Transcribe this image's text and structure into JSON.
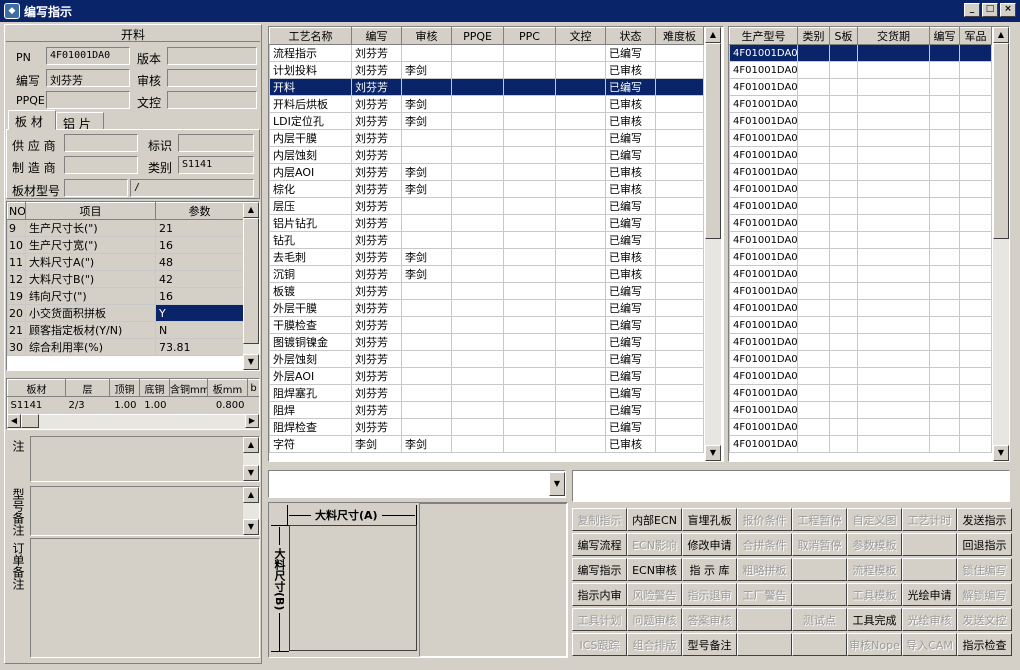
{
  "window": {
    "title": "编写指示",
    "min": "_",
    "max": "□",
    "close": "×"
  },
  "left": {
    "header": "开料",
    "pn_label": "PN",
    "pn_value": "4F01001DA0",
    "version_label": "版本",
    "version_value": "",
    "author_label": "编写",
    "author_value": "刘芬芳",
    "review_label": "审核",
    "review_value": "",
    "ppqe_label": "PPQE",
    "ppqe_value": "",
    "doc_label": "文控",
    "doc_value": "",
    "tabs": [
      "板 材",
      "铝 片"
    ],
    "supplier_label": "供 应 商",
    "supplier_value": "",
    "mark_label": "标识",
    "mark_value": "",
    "maker_label": "制 造 商",
    "maker_value": "",
    "type_label": "类别",
    "type_value": "S1141",
    "model_label": "板材型号",
    "model_value": "",
    "model_value2": "/",
    "param_headers": [
      "NO",
      "项目",
      "参数"
    ],
    "params": [
      {
        "no": "9",
        "item": "生产尺寸长(\")",
        "val": "21"
      },
      {
        "no": "10",
        "item": "生产尺寸宽(\")",
        "val": "16"
      },
      {
        "no": "11",
        "item": "大料尺寸A(\")",
        "val": "48"
      },
      {
        "no": "12",
        "item": "大料尺寸B(\")",
        "val": "42"
      },
      {
        "no": "19",
        "item": "纬向尺寸(\")",
        "val": "16"
      },
      {
        "no": "20",
        "item": "小交货面积拼板",
        "val": "Y"
      },
      {
        "no": "21",
        "item": "顾客指定板材(Y/N)",
        "val": "N"
      },
      {
        "no": "30",
        "item": "综合利用率(%)",
        "val": "73.81"
      }
    ],
    "board_headers": [
      "板材",
      "层",
      "顶铜",
      "底铜",
      "含铜mm",
      "板mm",
      "b"
    ],
    "board_row": [
      "S1141",
      "2/3",
      "1.00",
      "1.00",
      "",
      "0.800",
      ""
    ],
    "notes": [
      "工艺备注",
      "型号备注",
      "订单备注"
    ]
  },
  "process": {
    "headers": [
      "工艺名称",
      "编写",
      "审核",
      "PPQE",
      "PPC",
      "文控",
      "状态",
      "难度板"
    ],
    "rows": [
      [
        "流程指示",
        "刘芬芳",
        "",
        "",
        "",
        "",
        "已编写",
        ""
      ],
      [
        "计划投料",
        "刘芬芳",
        "李剑",
        "",
        "",
        "",
        "已审核",
        ""
      ],
      [
        "开料",
        "刘芬芳",
        "",
        "",
        "",
        "",
        "已编写",
        ""
      ],
      [
        "开料后烘板",
        "刘芬芳",
        "李剑",
        "",
        "",
        "",
        "已审核",
        ""
      ],
      [
        "LDI定位孔",
        "刘芬芳",
        "李剑",
        "",
        "",
        "",
        "已审核",
        ""
      ],
      [
        "内层干膜",
        "刘芬芳",
        "",
        "",
        "",
        "",
        "已编写",
        ""
      ],
      [
        "内层蚀刻",
        "刘芬芳",
        "",
        "",
        "",
        "",
        "已编写",
        ""
      ],
      [
        "内层AOI",
        "刘芬芳",
        "李剑",
        "",
        "",
        "",
        "已审核",
        ""
      ],
      [
        "棕化",
        "刘芬芳",
        "李剑",
        "",
        "",
        "",
        "已审核",
        ""
      ],
      [
        "层压",
        "刘芬芳",
        "",
        "",
        "",
        "",
        "已编写",
        ""
      ],
      [
        "铝片钻孔",
        "刘芬芳",
        "",
        "",
        "",
        "",
        "已编写",
        ""
      ],
      [
        "钻孔",
        "刘芬芳",
        "",
        "",
        "",
        "",
        "已编写",
        ""
      ],
      [
        "去毛刺",
        "刘芬芳",
        "李剑",
        "",
        "",
        "",
        "已审核",
        ""
      ],
      [
        "沉铜",
        "刘芬芳",
        "李剑",
        "",
        "",
        "",
        "已审核",
        ""
      ],
      [
        "板镀",
        "刘芬芳",
        "",
        "",
        "",
        "",
        "已编写",
        ""
      ],
      [
        "外层干膜",
        "刘芬芳",
        "",
        "",
        "",
        "",
        "已编写",
        ""
      ],
      [
        "干膜检查",
        "刘芬芳",
        "",
        "",
        "",
        "",
        "已编写",
        ""
      ],
      [
        "图镀铜镍金",
        "刘芬芳",
        "",
        "",
        "",
        "",
        "已编写",
        ""
      ],
      [
        "外层蚀刻",
        "刘芬芳",
        "",
        "",
        "",
        "",
        "已编写",
        ""
      ],
      [
        "外层AOI",
        "刘芬芳",
        "",
        "",
        "",
        "",
        "已编写",
        ""
      ],
      [
        "阻焊塞孔",
        "刘芬芳",
        "",
        "",
        "",
        "",
        "已编写",
        ""
      ],
      [
        "阻焊",
        "刘芬芳",
        "",
        "",
        "",
        "",
        "已编写",
        ""
      ],
      [
        "阻焊检查",
        "刘芬芳",
        "",
        "",
        "",
        "",
        "已编写",
        ""
      ],
      [
        "字符",
        "李剑",
        "李剑",
        "",
        "",
        "",
        "已审核",
        ""
      ]
    ]
  },
  "models": {
    "headers": [
      "生产型号",
      "类别",
      "S板",
      "交货期",
      "编写",
      "军品"
    ],
    "rows": [
      "4F01001DA0",
      "4F01001DA0",
      "4F01001DA0",
      "4F01001DA0",
      "4F01001DA0",
      "4F01001DA0",
      "4F01001DA0",
      "4F01001DA0",
      "4F01001DA0",
      "4F01001DA0",
      "4F01001DA0",
      "4F01001DA0",
      "4F01001DA0",
      "4F01001DA0",
      "4F01001DA0",
      "4F01001DA0",
      "4F01001DA0",
      "4F01001DA0",
      "4F01001DA0",
      "4F01001DA0",
      "4F01001DA0",
      "4F01001DA0",
      "4F01001DA0",
      "4F01001DA0"
    ]
  },
  "diagram": {
    "a_label": "大料尺寸(A)",
    "b_label": "大料尺寸(B)"
  },
  "buttons": [
    [
      {
        "t": "复制指示",
        "d": true
      },
      {
        "t": "内部ECN",
        "d": false
      },
      {
        "t": "盲埋孔板",
        "d": false
      },
      {
        "t": "报价条件",
        "d": true
      },
      {
        "t": "工程暂停",
        "d": true
      },
      {
        "t": "自定义图",
        "d": true
      },
      {
        "t": "工艺计时",
        "d": true
      },
      {
        "t": "发送指示",
        "d": false
      }
    ],
    [
      {
        "t": "编写流程",
        "d": false
      },
      {
        "t": "ECN影响",
        "d": true
      },
      {
        "t": "修改申请",
        "d": false
      },
      {
        "t": "合拼条件",
        "d": true
      },
      {
        "t": "取消暂停",
        "d": true
      },
      {
        "t": "参数模板",
        "d": true
      },
      {
        "t": "",
        "d": false
      },
      {
        "t": "回退指示",
        "d": false
      }
    ],
    [
      {
        "t": "编写指示",
        "d": false
      },
      {
        "t": "ECN审核",
        "d": false
      },
      {
        "t": "指 示 库",
        "d": false
      },
      {
        "t": "粗略拼板",
        "d": true
      },
      {
        "t": "",
        "d": false
      },
      {
        "t": "流程模板",
        "d": true
      },
      {
        "t": "",
        "d": false
      },
      {
        "t": "锁住编写",
        "d": true
      }
    ],
    [
      {
        "t": "指示内审",
        "d": false
      },
      {
        "t": "风险警告",
        "d": true
      },
      {
        "t": "指示退审",
        "d": true
      },
      {
        "t": "工厂警告",
        "d": true
      },
      {
        "t": "",
        "d": false
      },
      {
        "t": "工具模板",
        "d": true
      },
      {
        "t": "光绘申请",
        "d": false
      },
      {
        "t": "解锁编写",
        "d": true
      }
    ],
    [
      {
        "t": "工具计划",
        "d": true
      },
      {
        "t": "问题审核",
        "d": true
      },
      {
        "t": "答案审核",
        "d": true
      },
      {
        "t": "",
        "d": false
      },
      {
        "t": "测试点",
        "d": true
      },
      {
        "t": "工具完成",
        "d": false
      },
      {
        "t": "光绘审核",
        "d": true
      },
      {
        "t": "发送文控",
        "d": true
      }
    ],
    [
      {
        "t": "ICS跟踪",
        "d": true
      },
      {
        "t": "组合排版",
        "d": true
      },
      {
        "t": "型号备注",
        "d": false
      },
      {
        "t": "",
        "d": false
      },
      {
        "t": "",
        "d": false
      },
      {
        "t": "审核Nope",
        "d": true
      },
      {
        "t": "导入CAM",
        "d": true
      },
      {
        "t": "指示检查",
        "d": false
      }
    ]
  ]
}
